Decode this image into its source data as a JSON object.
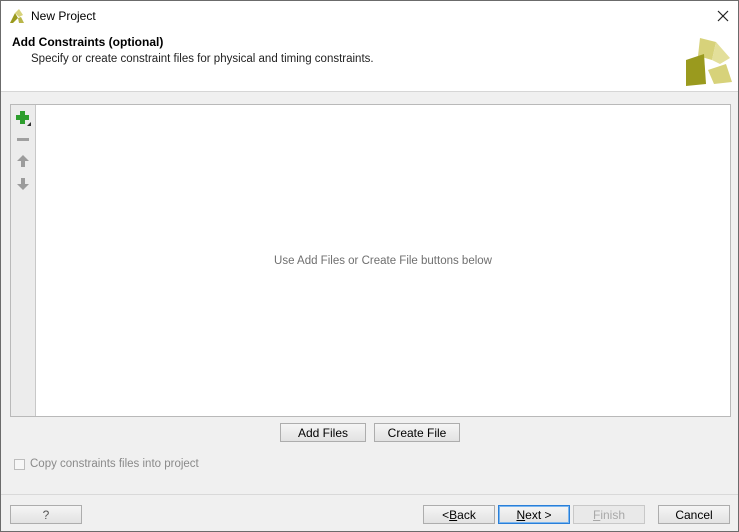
{
  "window": {
    "title": "New Project"
  },
  "header": {
    "title": "Add Constraints (optional)",
    "subtitle": "Specify or create constraint files for physical and timing constraints."
  },
  "panel": {
    "empty_hint": "Use Add Files or Create File buttons below",
    "tools": [
      "add-icon",
      "remove-icon",
      "move-up-icon",
      "move-down-icon"
    ]
  },
  "actions": {
    "add_files": "Add Files",
    "create_file": "Create File"
  },
  "options": {
    "copy_label": "Copy constraints files into project",
    "copy_checked": false
  },
  "footer": {
    "help": "?",
    "back_prefix": "< ",
    "back_mnemonic": "B",
    "back_rest": "ack",
    "next_mnemonic": "N",
    "next_rest": "ext >",
    "finish_mnemonic": "F",
    "finish_rest": "inish",
    "cancel": "Cancel"
  },
  "colors": {
    "accent_green": "#2e9e2e",
    "logo_olive": "#9a9a1e",
    "logo_yellow": "#d7d27a",
    "focus_blue": "#2a7fd8"
  }
}
